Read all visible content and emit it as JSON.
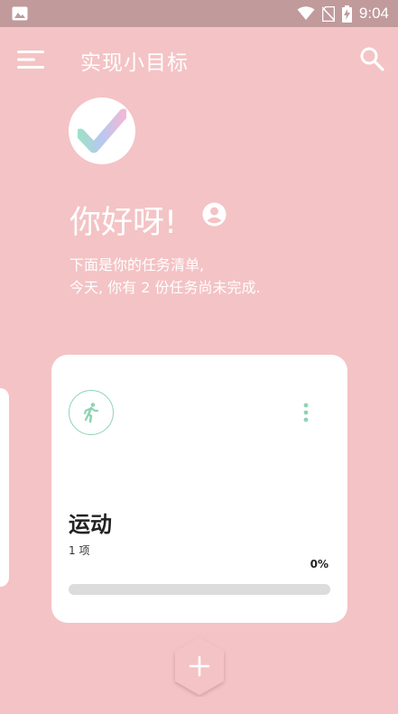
{
  "status_bar": {
    "time": "9:04"
  },
  "app_bar": {
    "title": "实现小目标"
  },
  "greeting": "你好呀!",
  "summary": {
    "line1": "下面是你的任务清单,",
    "line2": "今天, 你有 2 份任务尚未完成."
  },
  "task_card": {
    "title": "运动",
    "count": "1 项",
    "progress_label": "0%",
    "progress": 0,
    "icon": "running-person-icon"
  },
  "colors": {
    "background": "#f4c3c5",
    "status_bar": "#c19a9b",
    "accent": "#8fd3b3",
    "card": "#ffffff"
  }
}
